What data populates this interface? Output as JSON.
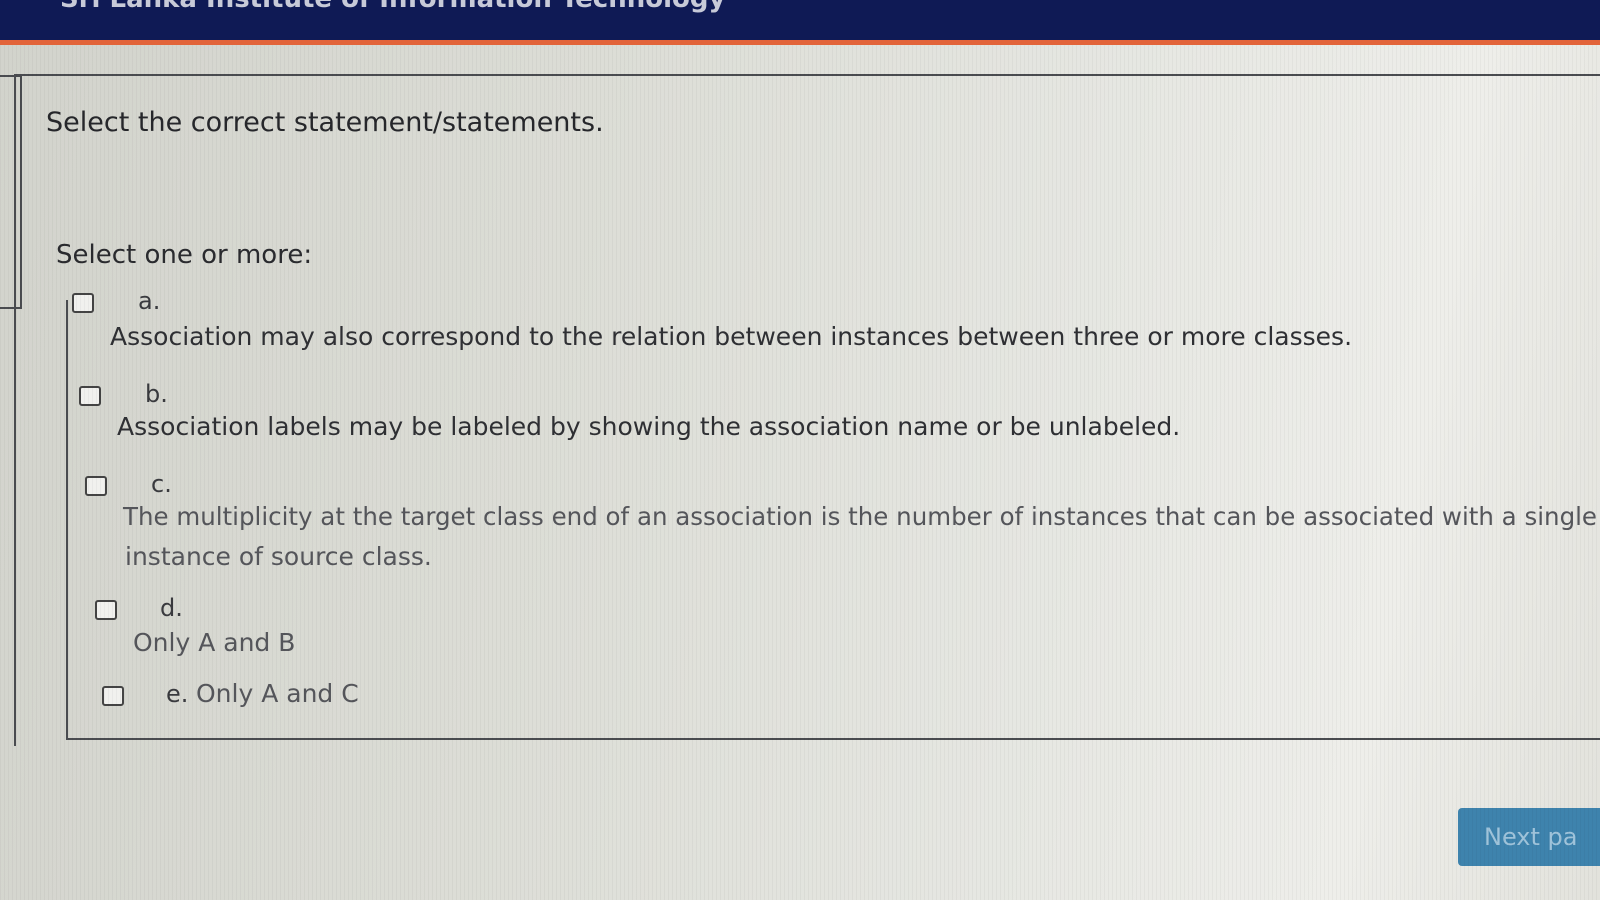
{
  "header": {
    "title": "Sri Lanka Institute of Information Technology"
  },
  "question": {
    "prompt": "Select the correct statement/statements.",
    "instruction": "Select one or more:",
    "options": [
      {
        "letter": "a.",
        "text": "Association may also correspond to the relation between instances between three or more classes.",
        "checked": false
      },
      {
        "letter": "b.",
        "text": "Association labels may be labeled by showing the association name or be unlabeled.",
        "checked": false
      },
      {
        "letter": "c.",
        "text_line1": "The multiplicity at the target class end of an association is the number of instances that can be associated with a single",
        "text_line2": "instance of source class.",
        "checked": false
      },
      {
        "letter": "d.",
        "text": "Only A and B",
        "checked": false
      },
      {
        "letter": "e.",
        "text": "Only A and C",
        "checked": false
      }
    ]
  },
  "navigation": {
    "next_label": "Next pa"
  },
  "colors": {
    "header_bg": "#0f1a55",
    "header_accent": "#e2643a",
    "button_bg": "#3e83ad"
  }
}
